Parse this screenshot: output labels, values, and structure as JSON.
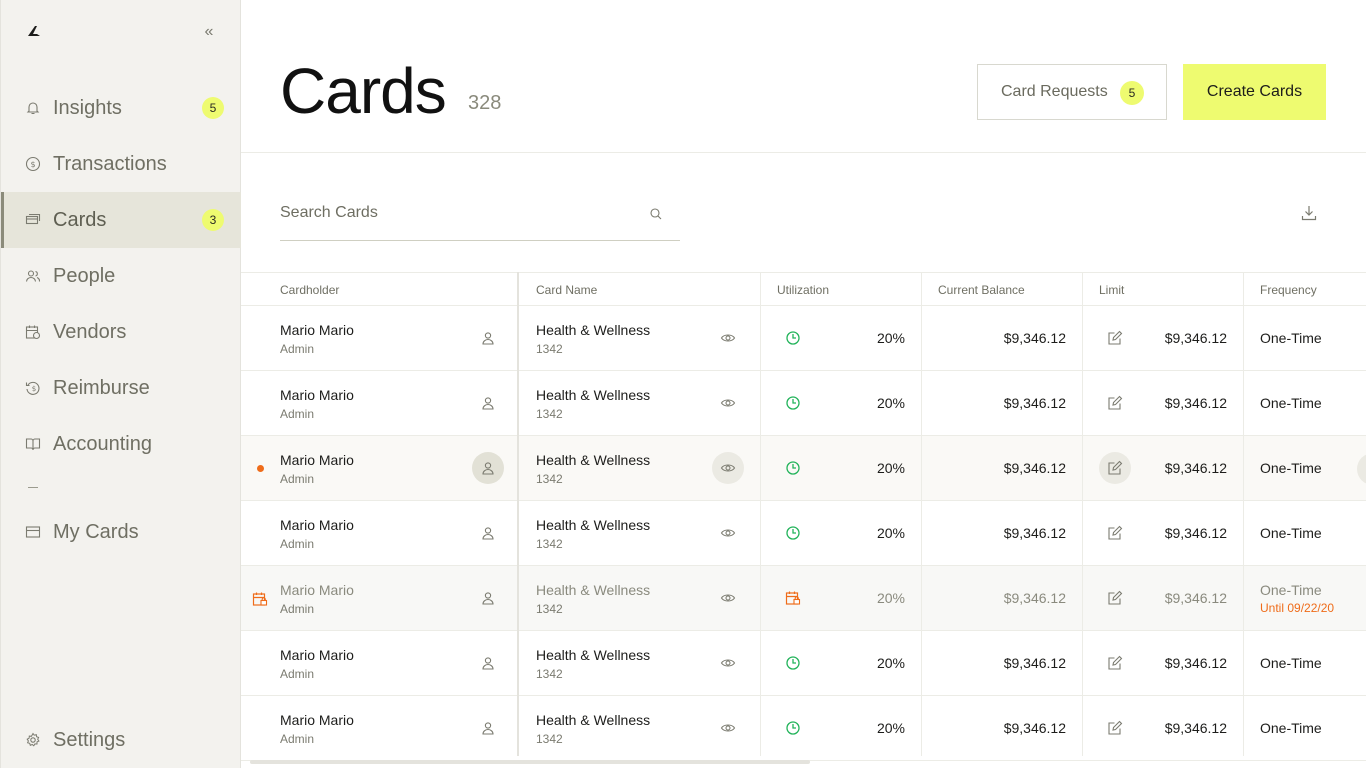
{
  "sidebar": {
    "items": [
      {
        "label": "Insights",
        "icon": "bell-icon",
        "badge": "5"
      },
      {
        "label": "Transactions",
        "icon": "dollar-circle-icon"
      },
      {
        "label": "Cards",
        "icon": "cards-icon",
        "badge": "3",
        "active": true
      },
      {
        "label": "People",
        "icon": "people-icon"
      },
      {
        "label": "Vendors",
        "icon": "vendor-calendar-icon"
      },
      {
        "label": "Reimburse",
        "icon": "reimburse-icon"
      },
      {
        "label": "Accounting",
        "icon": "book-icon"
      },
      {
        "label": "My Cards",
        "icon": "credit-card-icon"
      },
      {
        "label": "Settings",
        "icon": "gear-icon"
      }
    ]
  },
  "header": {
    "title": "Cards",
    "count": "328",
    "requests_label": "Card Requests",
    "requests_badge": "5",
    "create_label": "Create Cards"
  },
  "search": {
    "placeholder": "Search Cards"
  },
  "table": {
    "columns": [
      "Cardholder",
      "Card Name",
      "Utilization",
      "Current Balance",
      "Limit",
      "Frequency"
    ],
    "rows": [
      {
        "name": "Mario Mario",
        "role": "Admin",
        "card": "Health & Wellness",
        "num": "1342",
        "util": "20%",
        "balance": "$9,346.12",
        "limit": "$9,346.12",
        "freq": "One-Time"
      },
      {
        "name": "Mario Mario",
        "role": "Admin",
        "card": "Health & Wellness",
        "num": "1342",
        "util": "20%",
        "balance": "$9,346.12",
        "limit": "$9,346.12",
        "freq": "One-Time"
      },
      {
        "name": "Mario Mario",
        "role": "Admin",
        "card": "Health & Wellness",
        "num": "1342",
        "util": "20%",
        "balance": "$9,346.12",
        "limit": "$9,346.12",
        "freq": "One-Time",
        "state": "hover"
      },
      {
        "name": "Mario Mario",
        "role": "Admin",
        "card": "Health & Wellness",
        "num": "1342",
        "util": "20%",
        "balance": "$9,346.12",
        "limit": "$9,346.12",
        "freq": "One-Time"
      },
      {
        "name": "Mario Mario",
        "role": "Admin",
        "card": "Health & Wellness",
        "num": "1342",
        "util": "20%",
        "balance": "$9,346.12",
        "limit": "$9,346.12",
        "freq": "One-Time",
        "until": "Until 09/22/20",
        "state": "locked"
      },
      {
        "name": "Mario Mario",
        "role": "Admin",
        "card": "Health & Wellness",
        "num": "1342",
        "util": "20%",
        "balance": "$9,346.12",
        "limit": "$9,346.12",
        "freq": "One-Time"
      },
      {
        "name": "Mario Mario",
        "role": "Admin",
        "card": "Health & Wellness",
        "num": "1342",
        "util": "20%",
        "balance": "$9,346.12",
        "limit": "$9,346.12",
        "freq": "One-Time"
      }
    ]
  },
  "colors": {
    "accent": "#eefb70",
    "sidebar_bg": "#f3f2ee",
    "utilization_green": "#22b35a",
    "warning_orange": "#ef6c1a"
  }
}
